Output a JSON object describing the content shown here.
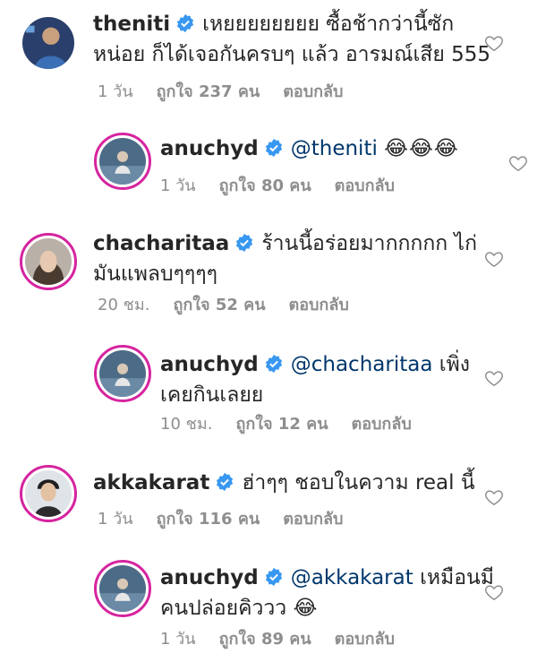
{
  "comments": [
    {
      "username": "theniti",
      "text_line1": "เหยยยยยยยย ซื้อช้ากว่านี้ซัก",
      "text_line2": "หน่อย ก็ได้เจอกันครบๆ แล้ว อารมณ์เสีย 555",
      "time": "1 วัน",
      "likes": "ถูกใจ 237 คน",
      "reply": "ตอบกลับ"
    },
    {
      "username": "anuchyd",
      "mention": "@theniti",
      "text_after": "😂😂😂",
      "time": "1 วัน",
      "likes": "ถูกใจ 80 คน",
      "reply": "ตอบกลับ"
    },
    {
      "username": "chacharitaa",
      "text_line1": "ร้านนี้อร่อยมากกกกก ไก่",
      "text_line2": "มันแพลบๆๆๆๆ",
      "time": "20 ชม.",
      "likes": "ถูกใจ 52 คน",
      "reply": "ตอบกลับ"
    },
    {
      "username": "anuchyd",
      "mention": "@chacharitaa",
      "text_after": "เพิ่ง",
      "text_line2": "เคยกินเลยย",
      "time": "10 ชม.",
      "likes": "ถูกใจ 12 คน",
      "reply": "ตอบกลับ"
    },
    {
      "username": "akkakarat",
      "text_line1": "ฮ่าๆๆ ชอบในความ real นี้",
      "time": "1 วัน",
      "likes": "ถูกใจ 116 คน",
      "reply": "ตอบกลับ"
    },
    {
      "username": "anuchyd",
      "mention": "@akkakarat",
      "text_after": "เหมือนมี",
      "text_line2": "คนปล่อยคิววว 😂",
      "time": "1 วัน",
      "likes": "ถูกใจ 89 คน",
      "reply": "ตอบกลับ"
    }
  ],
  "icons": {
    "verified": "verified-badge-icon",
    "like": "heart-outline-icon"
  },
  "colors": {
    "verified": "#3897f0",
    "mention": "#00376b",
    "meta": "#8e8e8e",
    "avatar_ring": "#d6249f"
  }
}
